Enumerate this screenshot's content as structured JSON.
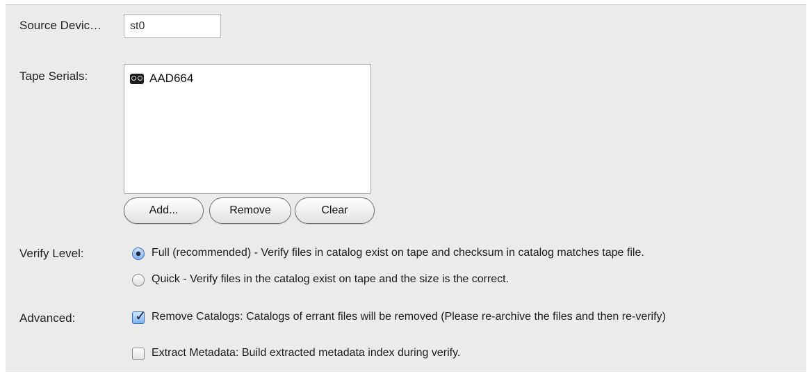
{
  "source_device": {
    "label": "Source Devic…",
    "value": "st0"
  },
  "tape_serials": {
    "label": "Tape Serials:",
    "items": [
      {
        "icon": "tape-cassette-icon",
        "serial": "AAD664"
      }
    ],
    "buttons": {
      "add": "Add...",
      "remove": "Remove",
      "clear": "Clear"
    }
  },
  "verify_level": {
    "label": "Verify Level:",
    "options": [
      {
        "text": "Full (recommended) - Verify files in catalog exist on tape and checksum in catalog matches tape file.",
        "selected": true
      },
      {
        "text": "Quick - Verify files in the catalog exist on tape and the size is the correct.",
        "selected": false
      }
    ]
  },
  "advanced": {
    "label": "Advanced:",
    "options": [
      {
        "text": "Remove Catalogs: Catalogs of errant files will be removed (Please re-archive the files and then re-verify)",
        "checked": true
      },
      {
        "text": "Extract Metadata: Build extracted metadata index during verify.",
        "checked": false
      }
    ]
  },
  "colors": {
    "panel_bg": "#ebebeb",
    "accent": "#3a6fb8"
  }
}
